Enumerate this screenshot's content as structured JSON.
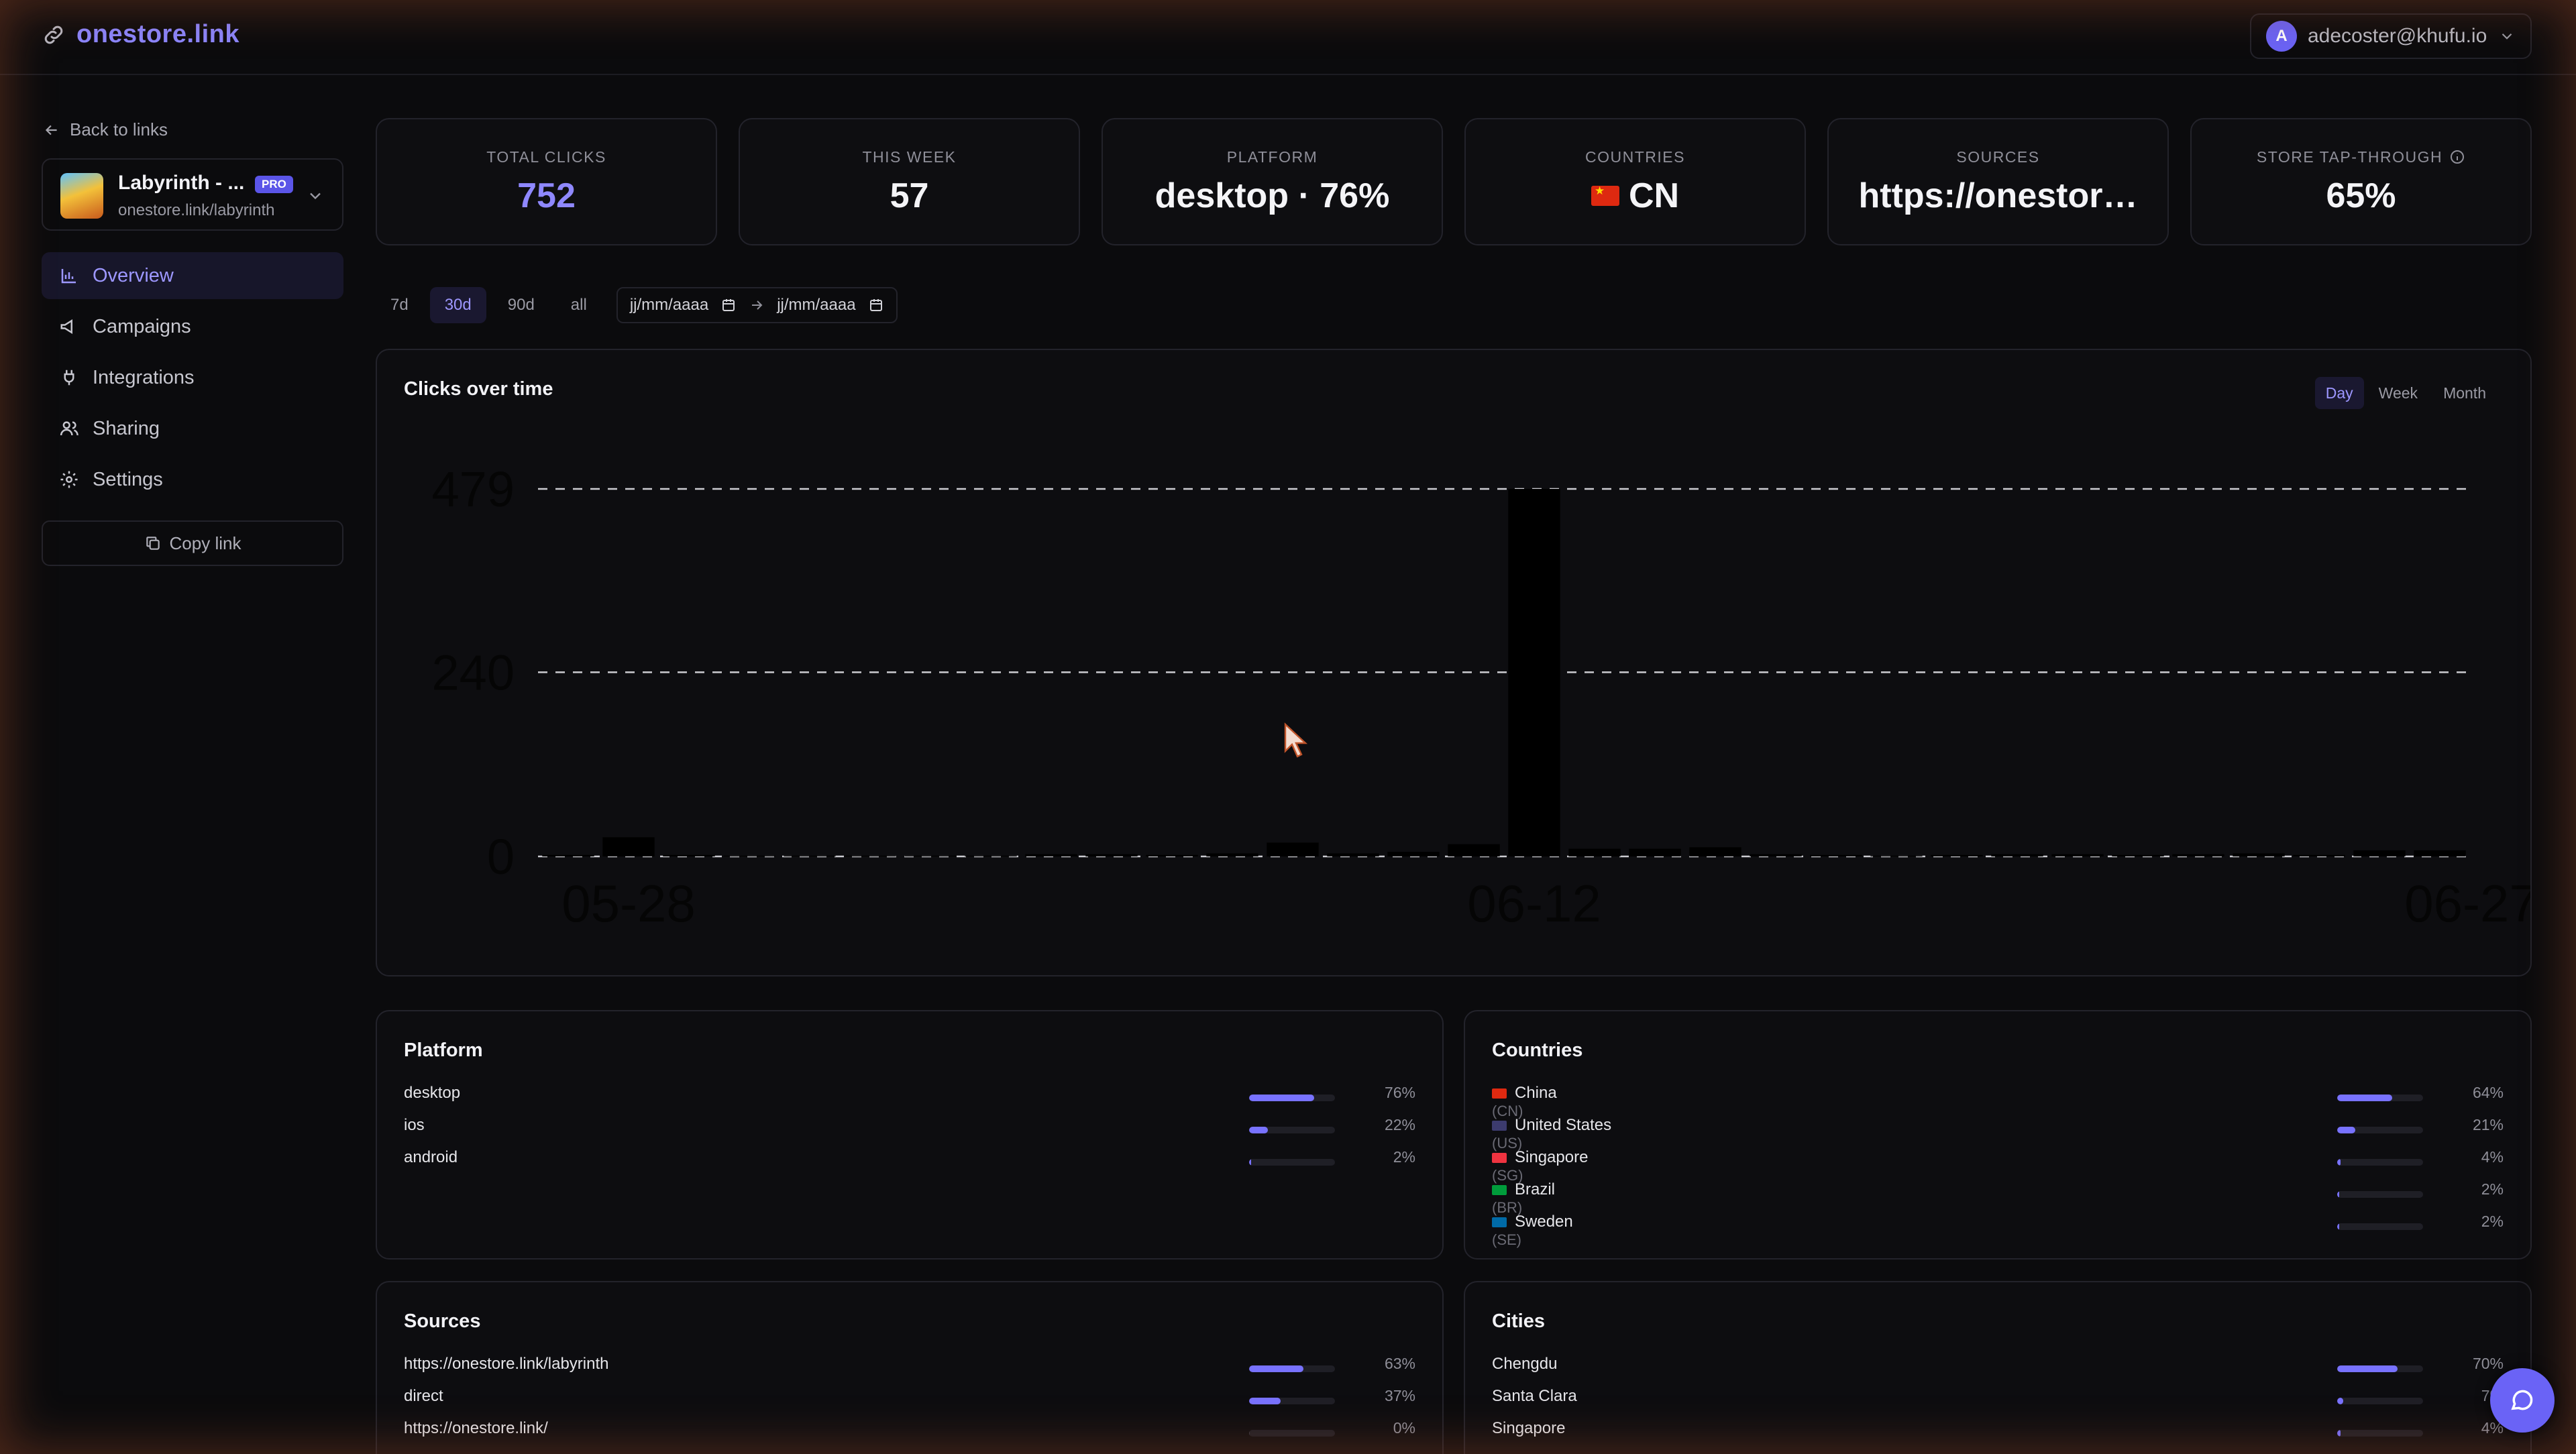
{
  "app": {
    "logo": "onestore.link",
    "account_avatar": "A",
    "account_email": "adecoster@khufu.io"
  },
  "sidebar": {
    "back": "Back to links",
    "link_name": "Labyrinth - ...",
    "badge": "PRO",
    "link_url": "onestore.link/labyrinth",
    "nav": [
      {
        "label": "Overview",
        "icon": "bar-chart-icon"
      },
      {
        "label": "Campaigns",
        "icon": "megaphone-icon"
      },
      {
        "label": "Integrations",
        "icon": "plug-icon"
      },
      {
        "label": "Sharing",
        "icon": "users-icon"
      },
      {
        "label": "Settings",
        "icon": "gear-icon"
      }
    ],
    "copy_link": "Copy link"
  },
  "stats": [
    {
      "label": "TOTAL CLICKS",
      "value": "752"
    },
    {
      "label": "THIS WEEK",
      "value": "57"
    },
    {
      "label": "PLATFORM",
      "value": "desktop · 76%"
    },
    {
      "label": "COUNTRIES",
      "value": "CN"
    },
    {
      "label": "SOURCES",
      "value": "https://onestor…"
    },
    {
      "label": "STORE TAP-THROUGH",
      "value": "65%"
    }
  ],
  "range": {
    "options": [
      "7d",
      "30d",
      "90d",
      "all"
    ],
    "active": "30d",
    "date_from": "jj/mm/aaaa",
    "date_to": "jj/mm/aaaa"
  },
  "chart_panel": {
    "title": "Clicks over time",
    "granularity": [
      "Day",
      "Week",
      "Month"
    ],
    "active": "Day"
  },
  "chart_data": {
    "type": "bar",
    "title": "Clicks over time",
    "xlabel": "",
    "ylabel": "",
    "yticks": [
      "0",
      "240",
      "479"
    ],
    "ylim": [
      0,
      479
    ],
    "xticks": [
      "05-28",
      "06-12",
      "06-27"
    ],
    "grid": true,
    "categories": [
      "05-27",
      "05-28",
      "05-29",
      "05-30",
      "05-31",
      "06-01",
      "06-02",
      "06-03",
      "06-04",
      "06-05",
      "06-06",
      "06-07",
      "06-08",
      "06-09",
      "06-10",
      "06-11",
      "06-12",
      "06-13",
      "06-14",
      "06-15",
      "06-16",
      "06-17",
      "06-18",
      "06-19",
      "06-20",
      "06-21",
      "06-22",
      "06-23",
      "06-24",
      "06-25",
      "06-26",
      "06-27"
    ],
    "values": [
      2,
      25,
      2,
      1,
      1,
      1,
      1,
      1,
      3,
      3,
      2,
      4,
      18,
      4,
      6,
      16,
      479,
      10,
      10,
      12,
      3,
      2,
      1,
      2,
      3,
      3,
      2,
      3,
      4,
      2,
      8,
      8
    ]
  },
  "platform": {
    "title": "Platform",
    "rows": [
      {
        "label": "desktop",
        "pct": "76%",
        "frac": 0.76
      },
      {
        "label": "ios",
        "pct": "22%",
        "frac": 0.22
      },
      {
        "label": "android",
        "pct": "2%",
        "frac": 0.02
      }
    ]
  },
  "countries": {
    "title": "Countries",
    "rows": [
      {
        "label": "China",
        "code": "(CN)",
        "pct": "64%",
        "frac": 0.64,
        "flag": "#de2910"
      },
      {
        "label": "United States",
        "code": "(US)",
        "pct": "21%",
        "frac": 0.21,
        "flag": "#3c3b6e"
      },
      {
        "label": "Singapore",
        "code": "(SG)",
        "pct": "4%",
        "frac": 0.04,
        "flag": "#ef3340"
      },
      {
        "label": "Brazil",
        "code": "(BR)",
        "pct": "2%",
        "frac": 0.02,
        "flag": "#009c3b"
      },
      {
        "label": "Sweden",
        "code": "(SE)",
        "pct": "2%",
        "frac": 0.02,
        "flag": "#006aa7"
      }
    ]
  },
  "sources": {
    "title": "Sources",
    "rows": [
      {
        "label": "https://onestore.link/labyrinth",
        "pct": "63%",
        "frac": 0.63
      },
      {
        "label": "direct",
        "pct": "37%",
        "frac": 0.37
      },
      {
        "label": "https://onestore.link/",
        "pct": "0%",
        "frac": 0.0
      }
    ]
  },
  "cities": {
    "title": "Cities",
    "rows": [
      {
        "label": "Chengdu",
        "pct": "70%",
        "frac": 0.7
      },
      {
        "label": "Santa Clara",
        "pct": "7%",
        "frac": 0.07
      },
      {
        "label": "Singapore",
        "pct": "4%",
        "frac": 0.04
      }
    ]
  }
}
